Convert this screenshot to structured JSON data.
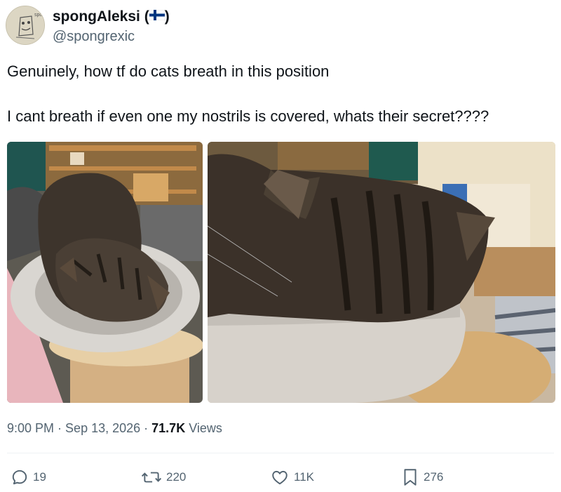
{
  "author": {
    "display_name": "spongAleksi (",
    "display_name_suffix": ")",
    "flag_icon": "finland-flag-icon",
    "handle": "@spongrexic",
    "avatar_icon": "sketch-avatar-icon",
    "avatar_text": "spong"
  },
  "tweet": {
    "line_1": "Genuinely, how tf do cats breath in this position",
    "line_2": "I cant breath if even one my nostrils is covered, whats their secret????"
  },
  "meta": {
    "time": "9:00 PM",
    "separator_1": " · ",
    "date": "Sep 13, 2026",
    "separator_2": " · ",
    "views_count": "71.7K",
    "views_label": " Views"
  },
  "actions": {
    "reply_count": "19",
    "retweet_count": "220",
    "like_count": "11K",
    "bookmark_count": "276"
  },
  "colors": {
    "text": "#0f1419",
    "secondary": "#536471",
    "flag_blue": "#003580",
    "divider": "#eff3f4"
  }
}
